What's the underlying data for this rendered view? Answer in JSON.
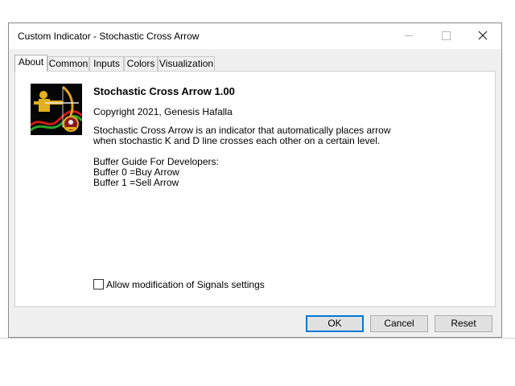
{
  "window": {
    "title": "Custom Indicator - Stochastic Cross Arrow"
  },
  "tabs": [
    {
      "label": "About",
      "active": true
    },
    {
      "label": "Common",
      "active": false
    },
    {
      "label": "Inputs",
      "active": false
    },
    {
      "label": "Colors",
      "active": false
    },
    {
      "label": "Visualization",
      "active": false
    }
  ],
  "about": {
    "indicator_name": "Stochastic Cross Arrow 1.00",
    "copyright": "Copyright 2021, Genesis Hafalla",
    "description": [
      "Stochastic Cross Arrow is an indicator that automatically places arrow",
      "when stochastic K and D line crosses each other on a certain level."
    ],
    "buffer_guide": [
      "Buffer Guide For Developers:",
      "Buffer 0 =Buy Arrow",
      "Buffer 1 =Sell Arrow"
    ],
    "logo_icon": "archer-logo-icon"
  },
  "allow_modification": {
    "label": "Allow modification of Signals settings",
    "checked": false
  },
  "buttons": {
    "ok": "OK",
    "cancel": "Cancel",
    "reset": "Reset"
  },
  "colors": {
    "accent": "#0078d7",
    "panel_bg": "#ffffff",
    "dialog_bg": "#f0f0f0"
  }
}
